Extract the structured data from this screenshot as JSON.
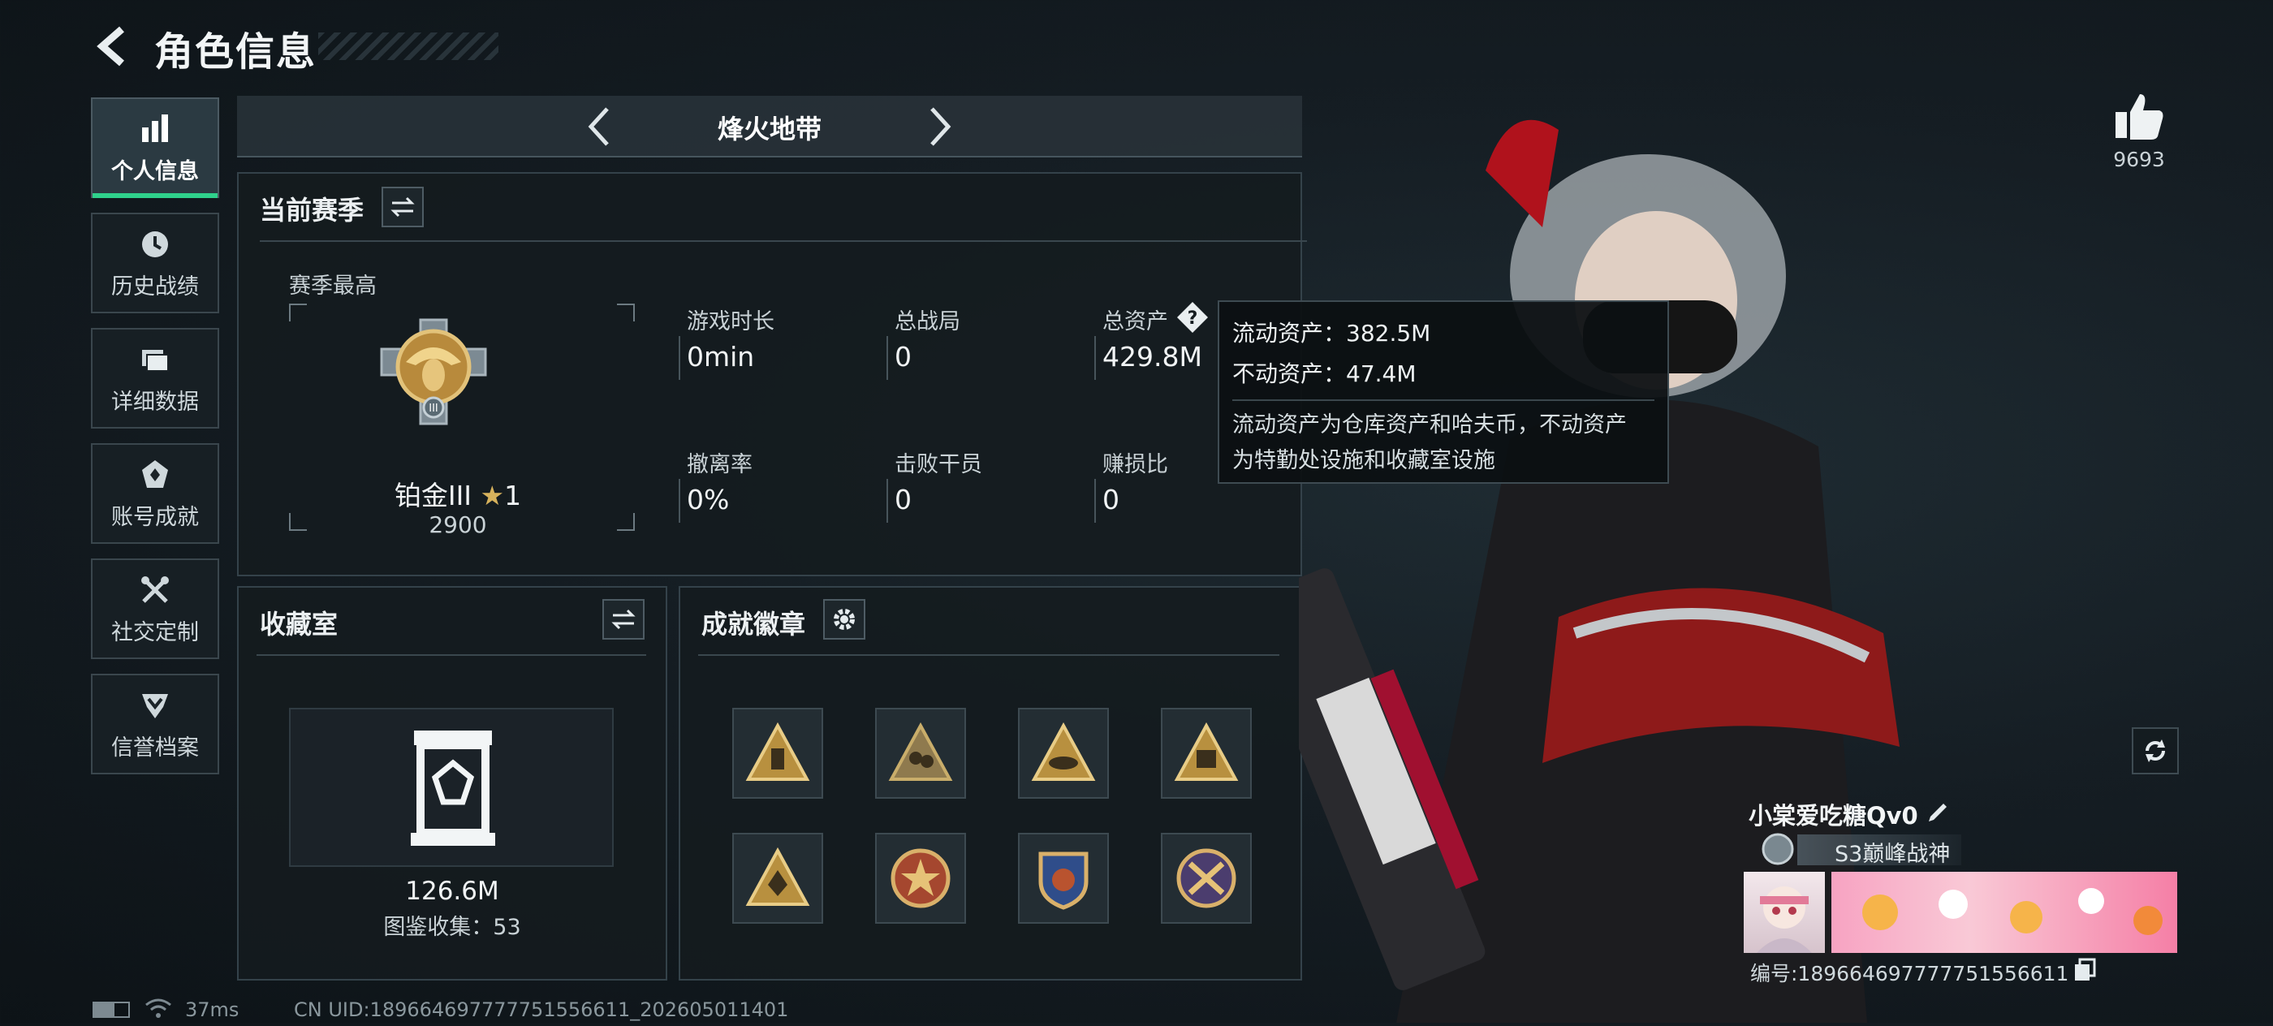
{
  "header": {
    "title": "角色信息"
  },
  "nav": [
    {
      "label": "个人信息",
      "icon": "bar-chart-icon",
      "active": true
    },
    {
      "label": "历史战绩",
      "icon": "clock-icon",
      "active": false
    },
    {
      "label": "详细数据",
      "icon": "folder-icon",
      "active": false
    },
    {
      "label": "账号成就",
      "icon": "medal-icon",
      "active": false
    },
    {
      "label": "社交定制",
      "icon": "tools-icon",
      "active": false
    },
    {
      "label": "信誉档案",
      "icon": "shield-rank-icon",
      "active": false
    }
  ],
  "mode": {
    "name": "烽火地带"
  },
  "season": {
    "title": "当前赛季",
    "best_label": "赛季最高",
    "rank_name": "铂金III",
    "rank_stars": "1",
    "rank_score": "2900",
    "stats": [
      {
        "label": "游戏时长",
        "value": "0min"
      },
      {
        "label": "总战局",
        "value": "0"
      },
      {
        "label": "总资产",
        "value": "429.8M"
      },
      {
        "label": "撤离率",
        "value": "0%"
      },
      {
        "label": "击败干员",
        "value": "0"
      },
      {
        "label": "赚损比",
        "value": "0"
      }
    ]
  },
  "tooltip": {
    "liquid": "流动资产：382.5M",
    "fixed": "不动资产：47.4M",
    "desc1": "流动资产为仓库资产和哈夫币，不动资产",
    "desc2": "为特勤处设施和收藏室设施"
  },
  "collection": {
    "title": "收藏室",
    "value": "126.6M",
    "count_label": "图鉴收集：53"
  },
  "achievements": {
    "title": "成就徽章"
  },
  "likes": {
    "count": "9693"
  },
  "player": {
    "name": "小棠爱吃糖Qv0",
    "title": "S3巅峰战神",
    "id_line": "编号:1896646977777515566​11"
  },
  "footer": {
    "ping": "37ms",
    "uid": "CN UID:189664697777751556611_202605011401"
  },
  "colors": {
    "accent": "#2fd18c",
    "gold": "#c9a45c"
  }
}
